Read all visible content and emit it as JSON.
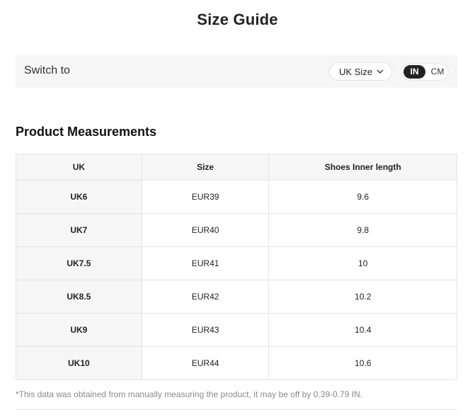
{
  "header": {
    "title": "Size Guide"
  },
  "switch": {
    "label": "Switch to",
    "size_system": "UK Size",
    "units": {
      "in": "IN",
      "cm": "CM",
      "selected": "IN"
    }
  },
  "measurements": {
    "title": "Product Measurements",
    "columns": [
      "UK",
      "Size",
      "Shoes Inner length"
    ],
    "rows": [
      [
        "UK6",
        "EUR39",
        "9.6"
      ],
      [
        "UK7",
        "EUR40",
        "9.8"
      ],
      [
        "UK7.5",
        "EUR41",
        "10"
      ],
      [
        "UK8.5",
        "EUR42",
        "10.2"
      ],
      [
        "UK9",
        "EUR43",
        "10.4"
      ],
      [
        "UK10",
        "EUR44",
        "10.6"
      ]
    ]
  },
  "footnote": "*This data was obtained from manually measuring the product, it may be off by 0.39-0.79 IN."
}
